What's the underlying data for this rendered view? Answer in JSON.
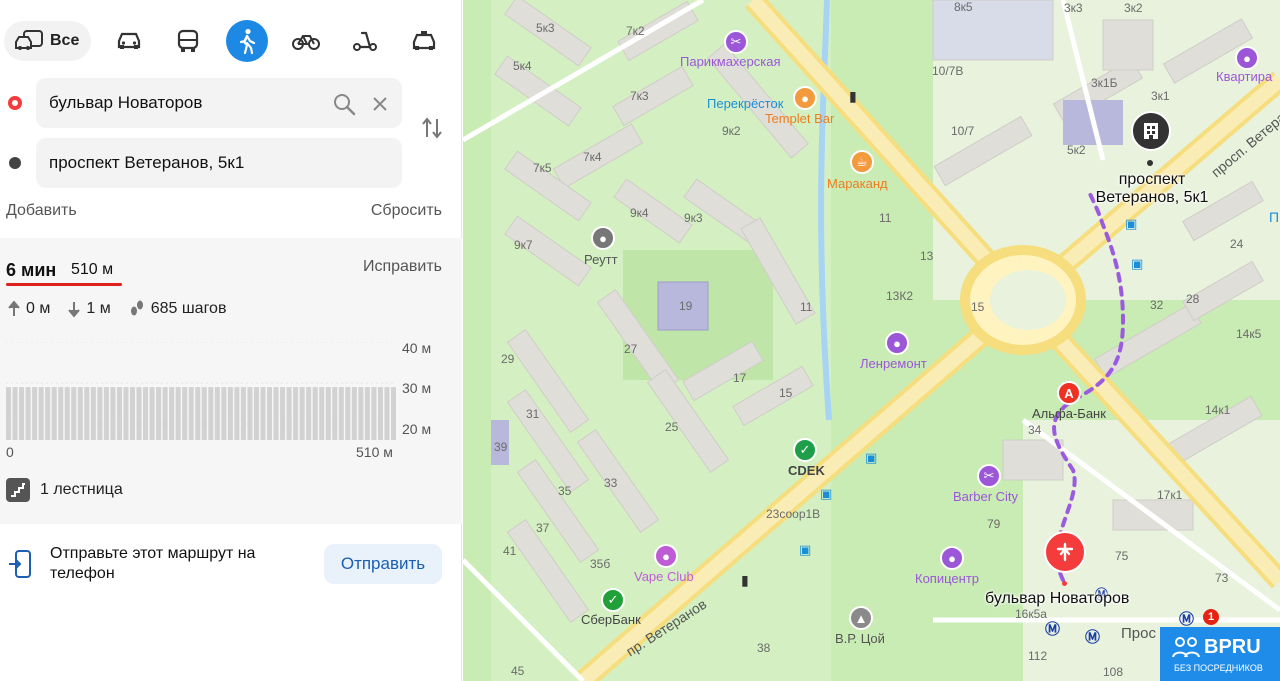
{
  "modes": {
    "all_label": "Все",
    "items": [
      "car-icon",
      "bus-icon",
      "pedestrian-icon",
      "bicycle-icon",
      "scooter-icon",
      "taxi-icon"
    ],
    "active": "pedestrian-icon",
    "accent": "#1e88e5"
  },
  "route": {
    "from": "бульвар Новаторов",
    "to": "проспект Ветеранов, 5к1"
  },
  "actions": {
    "add": "Добавить",
    "reset": "Сбросить"
  },
  "summary": {
    "time": "6 мин",
    "distance": "510 м",
    "fix": "Исправить",
    "ascent": "0 м",
    "descent": "1 м",
    "steps": "685 шагов"
  },
  "elevation": {
    "y_labels": [
      "40 м",
      "30 м",
      "20 м"
    ],
    "x_start": "0",
    "x_end": "510 м",
    "bar_level_m": 29
  },
  "stairs": "1 лестница",
  "send": {
    "text": "Отправьте этот маршрут на телефон",
    "button": "Отправить"
  },
  "map": {
    "labels": {
      "b1": "5к3",
      "b2": "7к2",
      "b3": "5к4",
      "b4": "7к3",
      "b5": "9к2",
      "b6": "7к4",
      "b7": "7к5",
      "b8": "9к4",
      "b9": "9к3",
      "b10": "9к7",
      "b11": "11",
      "b12": "13",
      "b13": "13К2",
      "b14": "15",
      "b15": "17",
      "b16": "15",
      "b17": "11",
      "b18": "19",
      "b19": "27",
      "b20": "25",
      "b21": "29",
      "b22": "31",
      "b23": "39",
      "b24": "33",
      "b25": "35",
      "b26": "37",
      "b27": "41",
      "b28": "35б",
      "b29": "23соор1В",
      "b30": "79",
      "b31": "75",
      "b32": "73",
      "b33": "17к1",
      "b34": "14к1",
      "b35": "14к5",
      "b36": "32",
      "b37": "28",
      "b38": "24",
      "b39": "34",
      "b40": "10/7В",
      "b41": "10/7",
      "b42": "3к3",
      "b43": "3к2",
      "b44": "3к1Б",
      "b45": "3к1",
      "b46": "5к2",
      "b47": "8к5",
      "b48": "38",
      "b49": "45",
      "b50": "112",
      "b51": "108",
      "b52": "16к5а"
    },
    "pois": {
      "hair": "Парикмахерская",
      "perekrestok": "Перекрёсток",
      "templet": "Templet Bar",
      "marakand": "Мараканд",
      "reutt": "Реутт",
      "lenremont": "Ленремонт",
      "alfa": "Альфа-Банк",
      "cdek": "CDEK",
      "barber": "Barber City",
      "vape": "Vape Club",
      "sber": "СберБанк",
      "kopi": "Копицентр",
      "vrtsoy": "В.Р. Цой",
      "kvartira": "Квартира"
    },
    "streets": {
      "veteranov_sw": "пр. Ветеранов",
      "veteranov_ne": "просп. Ветеранов",
      "pros": "Прос"
    },
    "destination_label": "проспект Ветеранов, 5к1",
    "origin_label": "бульвар Новаторов",
    "metro_badge": "1",
    "cut_label": "П"
  },
  "watermark": {
    "main": "BPRU",
    "sub": "БЕЗ ПОСРЕДНИКОВ"
  }
}
